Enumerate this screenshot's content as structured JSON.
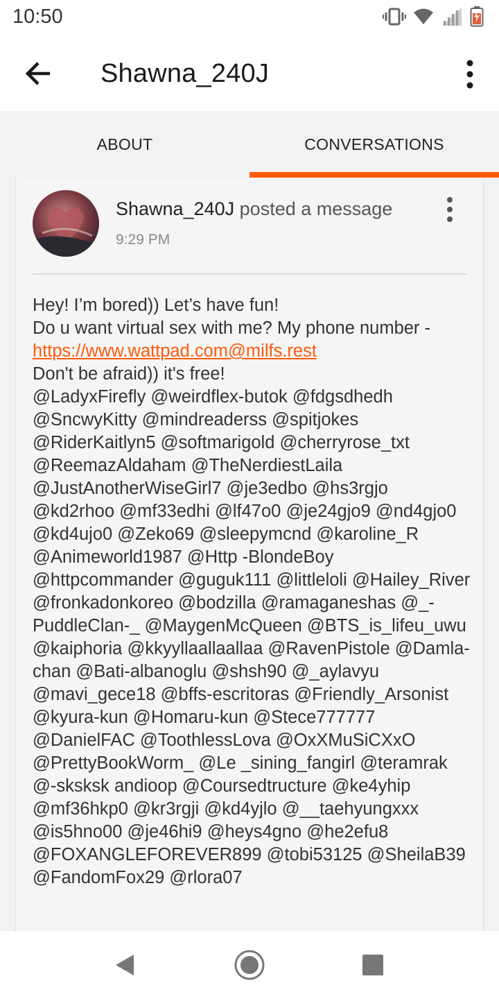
{
  "status_bar": {
    "time": "10:50",
    "icons": [
      "vibrate-icon",
      "wifi-icon",
      "signal-icon",
      "battery-icon"
    ]
  },
  "app_bar": {
    "title": "Shawna_240J",
    "back_icon": "arrow-back-icon",
    "menu_icon": "more-vert-icon"
  },
  "tabs": [
    {
      "label": "ABOUT",
      "active": false
    },
    {
      "label": "CONVERSATIONS",
      "active": true
    }
  ],
  "colors": {
    "accent": "#ff5a0a",
    "tab_background": "#f2f2f2",
    "card_background": "#f5f5f5"
  },
  "post": {
    "author": "Shawna_240J",
    "action": "posted a message",
    "time": "9:29 PM",
    "message_line1": "Hey! I’m bored)) Let’s have fun!",
    "message_line2": "Do u want virtual sex with me? My phone number - ",
    "link": "https://www.wattpad.com@milfs.rest",
    "message_line3": "Don't be afraid)) it's free!",
    "mentions": "@LadyxFirefly @weirdflex-butok @fdgsdhedh @SncwyKitty @mindreaderss @spitjokes @RiderKaitlyn5 @softmarigold @cherryrose_txt @ReemazAldaham @TheNerdiestLaila @JustAnotherWiseGirl7 @je3edbo @hs3rgjo @kd2rhoo @mf33edhi @lf47o0 @je24gjo9 @nd4gjo0 @kd4ujo0 @Zeko69 @sleepymcnd @karoline_R @Animeworld1987 @Http -BlondeBoy @httpcommander @guguk111 @littleloli @Hailey_River @fronkadonkoreo @bodzilla @ramaganeshas @_-PuddleClan-_ @MaygenMcQueen @BTS_is_lifeu_uwu @kaiphoria @kkyyllaallaallaa @RavenPistole @Damla-chan @Bati-albanoglu @shsh90 @_aylavyu @mavi_gece18 @bffs-escritoras @Friendly_Arsonist @kyura-kun @Homaru-kun @Stece777777 @DanielFAC @ToothlessLova @OxXMuSiCXxO @PrettyBookWorm_ @Le _sining_fangirl @teramrak @-sksksk andioop @Coursedtructure @ke4yhip @mf36hkp0 @kr3rgji @kd4yjlo @__taehyungxxx @is5hno00 @je46hi9 @heys4gno @he2efu8 @FOXANGLEFOREVER899 @tobi53125 @SheilaB39 @FandomFox29 @rlora07"
  },
  "nav_bar": {
    "icons": [
      "back-triangle-icon",
      "home-circle-icon",
      "recents-square-icon"
    ]
  }
}
